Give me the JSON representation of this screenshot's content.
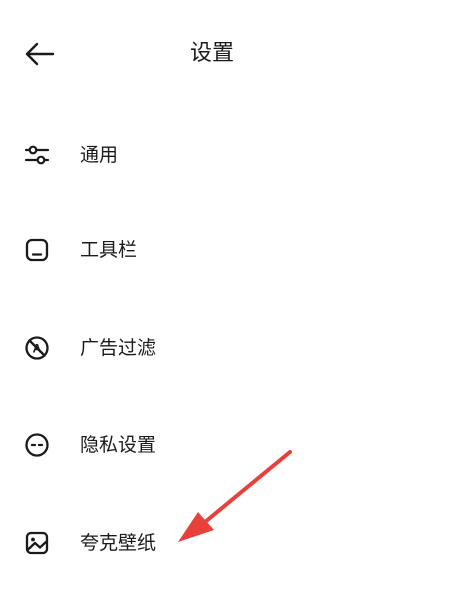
{
  "header": {
    "title": "设置",
    "back_icon": "arrow-left-icon"
  },
  "menu": {
    "items": [
      {
        "label": "通用",
        "icon": "sliders-icon"
      },
      {
        "label": "工具栏",
        "icon": "toolbar-icon"
      },
      {
        "label": "广告过滤",
        "icon": "ad-filter-icon"
      },
      {
        "label": "隐私设置",
        "icon": "privacy-mask-icon"
      },
      {
        "label": "夸克壁纸",
        "icon": "wallpaper-image-icon"
      }
    ]
  },
  "annotation": {
    "arrow_color": "#e8413c",
    "points_to": "夸克壁纸"
  },
  "colors": {
    "text": "#1a1a1a",
    "background": "#ffffff",
    "annotation_red": "#e8413c"
  }
}
